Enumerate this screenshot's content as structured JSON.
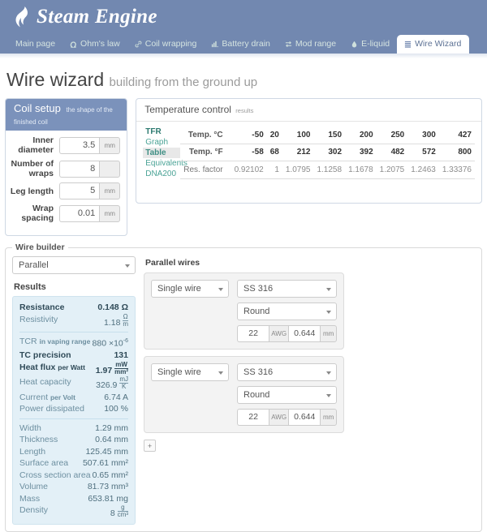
{
  "header": {
    "brand": "Steam Engine",
    "logo_icon": "flame-icon",
    "bg": "#7288b0"
  },
  "nav": {
    "items": [
      {
        "label": "Main page",
        "icon": "",
        "active": false
      },
      {
        "label": "Ohm's law",
        "icon": "omega-icon",
        "active": false
      },
      {
        "label": "Coil wrapping",
        "icon": "link-icon",
        "active": false
      },
      {
        "label": "Battery drain",
        "icon": "bar-chart-icon",
        "active": false
      },
      {
        "label": "Mod range",
        "icon": "exchange-icon",
        "active": false
      },
      {
        "label": "E-liquid",
        "icon": "droplet-icon",
        "active": false
      },
      {
        "label": "Wire Wizard",
        "icon": "list-icon",
        "active": true
      }
    ]
  },
  "page": {
    "title": "Wire wizard",
    "subtitle": "building from the ground up"
  },
  "coil_setup": {
    "title": "Coil setup",
    "subtitle": "the shape of the finished coil",
    "fields": [
      {
        "label": "Inner diameter",
        "value": "3.5",
        "unit": "mm"
      },
      {
        "label": "Number of wraps",
        "value": "8",
        "unit": ""
      },
      {
        "label": "Leg length",
        "value": "5",
        "unit": "mm"
      },
      {
        "label": "Wrap spacing",
        "value": "0.01",
        "unit": "mm"
      }
    ]
  },
  "temperature_control": {
    "title": "Temperature control",
    "subtitle": "results",
    "side_tabs": [
      {
        "label": "TFR",
        "state": "header"
      },
      {
        "label": "Graph",
        "state": "link"
      },
      {
        "label": "Table",
        "state": "selected"
      },
      {
        "label": "Equivalents",
        "state": "link"
      },
      {
        "label": "DNA200",
        "state": "link"
      }
    ],
    "rows": [
      {
        "label": "Temp. °C",
        "values": [
          "-50",
          "20",
          "100",
          "150",
          "200",
          "250",
          "300",
          "427"
        ]
      },
      {
        "label": "Temp. °F",
        "values": [
          "-58",
          "68",
          "212",
          "302",
          "392",
          "482",
          "572",
          "800"
        ]
      },
      {
        "label": "Res. factor",
        "values": [
          "0.92102",
          "1",
          "1.0795",
          "1.1258",
          "1.1678",
          "1.2075",
          "1.2463",
          "1.33376"
        ]
      }
    ]
  },
  "wire_builder": {
    "legend": "Wire builder",
    "mode": "Parallel",
    "results_title": "Results",
    "results": [
      {
        "key": "Resistance",
        "value": "0.148 Ω",
        "bold": true
      },
      {
        "key": "Resistivity",
        "value": "1.18",
        "unit_num": "Ω",
        "unit_den": "m",
        "bold": false
      },
      {
        "sep": true
      },
      {
        "key": "TCR",
        "key_small": "in vaping range",
        "value": "880 ×10",
        "sup": "-6",
        "bold": false
      },
      {
        "key": "TC precision",
        "value": "131",
        "bold": true
      },
      {
        "key": "Heat flux",
        "key_small": "per Watt",
        "value": "1.97",
        "unit_num": "mW",
        "unit_den": "mm²",
        "bold": true
      },
      {
        "key": "Heat capacity",
        "value": "326.9",
        "unit_num": "mJ",
        "unit_den": "K",
        "bold": false
      },
      {
        "key": "Current",
        "key_small": "per Volt",
        "value": "6.74 A",
        "bold": false
      },
      {
        "key": "Power dissipated",
        "value": "100 %",
        "bold": false
      },
      {
        "sep": true
      },
      {
        "key": "Width",
        "value": "1.29 mm",
        "bold": false
      },
      {
        "key": "Thickness",
        "value": "0.64 mm",
        "bold": false
      },
      {
        "key": "Length",
        "value": "125.45 mm",
        "bold": false
      },
      {
        "key": "Surface area",
        "value": "507.61 mm²",
        "bold": false
      },
      {
        "key": "Cross section area",
        "value": "0.65 mm²",
        "bold": false
      },
      {
        "key": "Volume",
        "value": "81.73 mm³",
        "bold": false
      },
      {
        "key": "Mass",
        "value": "653.81 mg",
        "bold": false
      },
      {
        "key": "Density",
        "value": "8",
        "unit_num": "g",
        "unit_den": "cm³",
        "bold": false
      }
    ],
    "parallel_wires_title": "Parallel wires",
    "wires": [
      {
        "type": "Single wire",
        "material": "SS 316",
        "shape": "Round",
        "gauge": "22",
        "gauge_unit": "AWG",
        "diameter": "0.644",
        "diameter_unit": "mm"
      },
      {
        "type": "Single wire",
        "material": "SS 316",
        "shape": "Round",
        "gauge": "22",
        "gauge_unit": "AWG",
        "diameter": "0.644",
        "diameter_unit": "mm"
      }
    ],
    "add_label": "+"
  }
}
